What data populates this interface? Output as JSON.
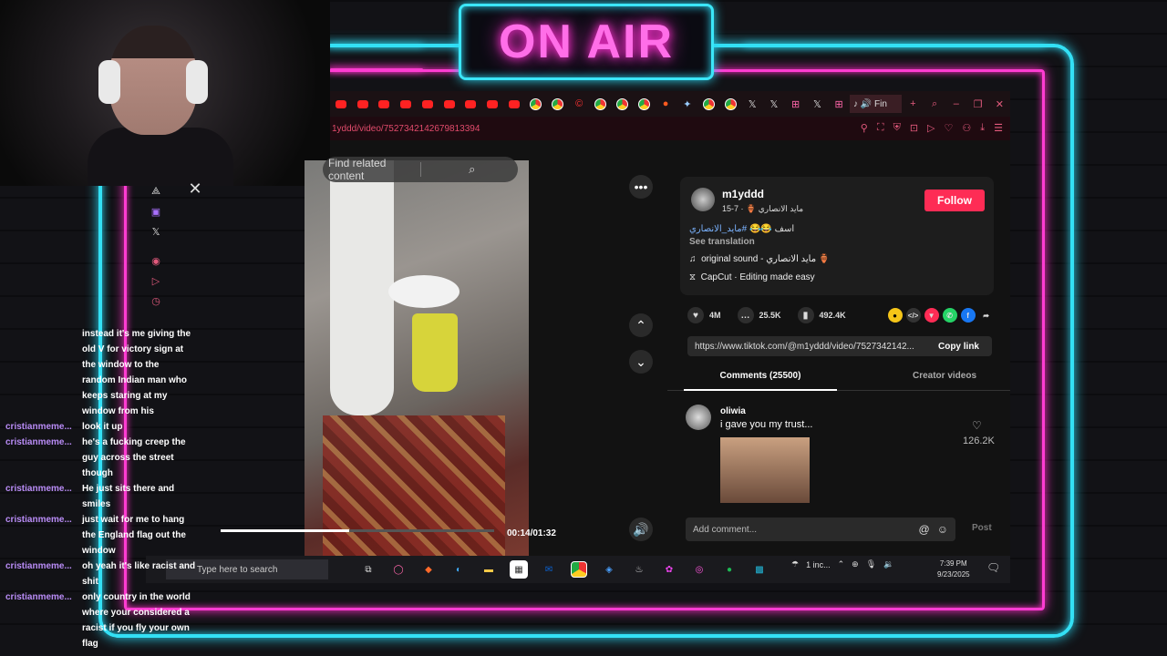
{
  "banner": {
    "text": "ON AIR"
  },
  "browser": {
    "url": "1yddd/video/7527342142679813394",
    "tab_label": "Fin"
  },
  "video": {
    "search_placeholder": "Find related content",
    "time": "00:14/01:32",
    "progress": 0.47
  },
  "author": {
    "username": "m1yddd",
    "display_name": "مايد الانصاري 🏺",
    "date": "· 7-15",
    "follow_label": "Follow",
    "description_text": "اسف 😂😂",
    "description_tag": "#مايد_الانصاري",
    "see_translation": "See translation",
    "sound": "original sound - مايد الانصاري 🏺",
    "capcut": "CapCut · Editing made easy"
  },
  "stats": {
    "likes": "4M",
    "comments": "25.5K",
    "saves": "492.4K"
  },
  "link": {
    "url": "https://www.tiktok.com/@m1yddd/video/7527342142...",
    "copy_label": "Copy link"
  },
  "tabs": {
    "comments": "Comments (25500)",
    "creator": "Creator videos"
  },
  "comment": {
    "user": "oliwia",
    "text": "i gave you my trust...",
    "likes": "126.2K"
  },
  "add_comment": {
    "placeholder": "Add comment...",
    "post": "Post"
  },
  "taskbar": {
    "search": "Type here to search",
    "tray_text": "1 inc...",
    "time": "7:39 PM",
    "date": "9/23/2025"
  },
  "chat": [
    {
      "user": "",
      "msg": "instead it's me giving the"
    },
    {
      "user": "",
      "msg": "old V for victory sign at"
    },
    {
      "user": "",
      "msg": "the window to the"
    },
    {
      "user": "",
      "msg": "random Indian man who"
    },
    {
      "user": "",
      "msg": "keeps staring at my"
    },
    {
      "user": "",
      "msg": "window from his"
    },
    {
      "user": "cristianmeme...",
      "msg": "look it up"
    },
    {
      "user": "cristianmeme...",
      "msg": "he's a fucking creep the"
    },
    {
      "user": "",
      "msg": "guy across the street"
    },
    {
      "user": "",
      "msg": "though"
    },
    {
      "user": "cristianmeme...",
      "msg": "He just sits there and"
    },
    {
      "user": "",
      "msg": "smiles"
    },
    {
      "user": "cristianmeme...",
      "msg": "just wait for me to hang"
    },
    {
      "user": "",
      "msg": "the England flag out the"
    },
    {
      "user": "",
      "msg": "window"
    },
    {
      "user": "cristianmeme...",
      "msg": "oh yeah it's like racist and"
    },
    {
      "user": "",
      "msg": "shit"
    },
    {
      "user": "cristianmeme...",
      "msg": "only country in the world"
    },
    {
      "user": "",
      "msg": "where your considered a"
    },
    {
      "user": "",
      "msg": "racist if you fly your own"
    },
    {
      "user": "",
      "msg": "flag"
    }
  ]
}
